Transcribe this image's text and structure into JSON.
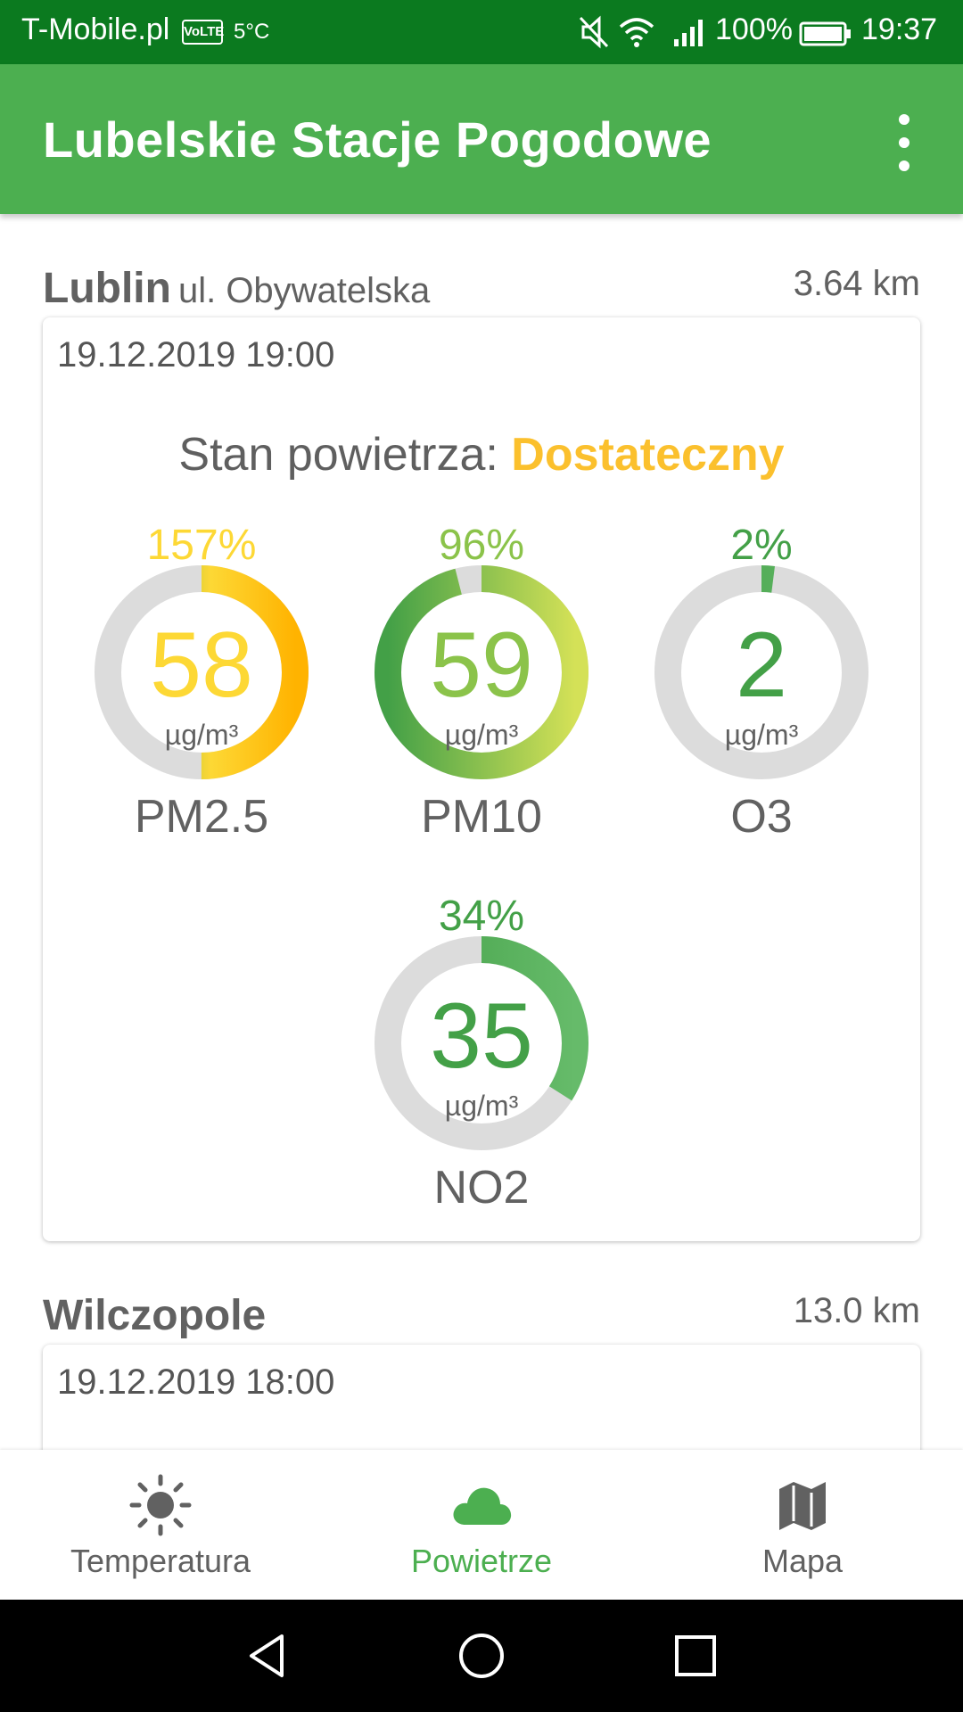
{
  "status_bar": {
    "carrier": "T-Mobile.pl",
    "volte": "VoLTE",
    "temperature": "5°C",
    "battery": "100%",
    "time": "19:37"
  },
  "app_bar": {
    "title": "Lubelskie Stacje Pogodowe"
  },
  "colors": {
    "primary": "#4caf50",
    "status_bar": "#0b7a1f",
    "warning": "#fbc02d",
    "gauge_track": "#dcdcdc"
  },
  "stations": [
    {
      "name": "Lublin",
      "street": "ul. Obywatelska",
      "distance": "3.64 km",
      "datetime": "19.12.2019 19:00",
      "status_label": "Stan powietrza:",
      "status_value": "Dostateczny",
      "gauges": [
        {
          "pollutant": "PM2.5",
          "value": "58",
          "unit": "µg/m³",
          "percent_label": "157%",
          "percent": 157,
          "color": "#fdd835"
        },
        {
          "pollutant": "PM10",
          "value": "59",
          "unit": "µg/m³",
          "percent_label": "96%",
          "percent": 96,
          "color": "#8bc34a"
        },
        {
          "pollutant": "O3",
          "value": "2",
          "unit": "µg/m³",
          "percent_label": "2%",
          "percent": 2,
          "color": "#43a047"
        },
        {
          "pollutant": "NO2",
          "value": "35",
          "unit": "µg/m³",
          "percent_label": "34%",
          "percent": 34,
          "color": "#43a047"
        }
      ]
    },
    {
      "name": "Wilczopole",
      "street": "",
      "distance": "13.0 km",
      "datetime": "19.12.2019 18:00"
    }
  ],
  "bottom_nav": {
    "items": [
      {
        "label": "Temperatura",
        "icon": "sun-icon",
        "active": false
      },
      {
        "label": "Powietrze",
        "icon": "cloud-icon",
        "active": true
      },
      {
        "label": "Mapa",
        "icon": "map-icon",
        "active": false
      }
    ]
  },
  "system_nav": {
    "items": [
      "back-icon",
      "home-icon",
      "recents-icon"
    ]
  }
}
